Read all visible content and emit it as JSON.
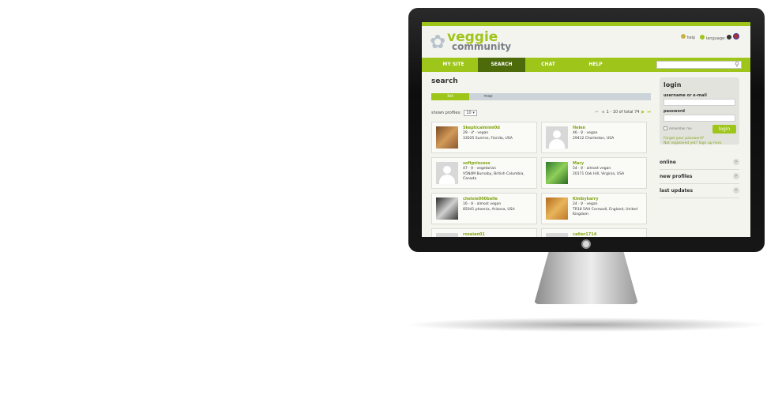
{
  "header": {
    "logo_top": "veggie",
    "logo_bottom": "community",
    "help": "help",
    "language": "language:"
  },
  "nav": {
    "tabs": [
      "MY SITE",
      "SEARCH",
      "CHAT",
      "HELP"
    ],
    "active": "SEARCH",
    "search_value": ""
  },
  "search": {
    "title": "search",
    "views": [
      "list",
      "map"
    ],
    "active_view": "list",
    "shown_profiles_label": "shown profiles:",
    "shown_profiles_value": "10",
    "pagination": "1 - 10 of total 74"
  },
  "profiles": [
    {
      "name": "Skepticalmimi0d",
      "meta": "29 · ♂ · vegan",
      "loc": "33025 Sunrise, Florida, USA",
      "loc2": ""
    },
    {
      "name": "Helen",
      "meta": "46 · ♀ · vegan",
      "loc": "29412 Charleston, USA",
      "loc2": ""
    },
    {
      "name": "softprincess",
      "meta": "47 · ♀ · vegetarian",
      "loc": "V5N4M Burnaby, British Columbia,",
      "loc2": "Canada"
    },
    {
      "name": "Mary",
      "meta": "54 · ♀ · almost vegan",
      "loc": "20171 Oak Hill, Virginia, USA",
      "loc2": ""
    },
    {
      "name": "chelsie000belle",
      "meta": "16 · ♀ · almost vegan",
      "loc": "85041 phoenix, Arizona, USA",
      "loc2": ""
    },
    {
      "name": "Kimbykarry",
      "meta": "24 · ♀ · vegan",
      "loc": "TR18 5AH Cornwall, England, United",
      "loc2": "Kingdom"
    },
    {
      "name": "roseien01",
      "meta": "",
      "loc": "",
      "loc2": ""
    },
    {
      "name": "calter1714",
      "meta": "",
      "loc": "",
      "loc2": ""
    }
  ],
  "login": {
    "title": "login",
    "username_label": "username or e-mail",
    "password_label": "password",
    "remember": "remember me",
    "button": "login",
    "forgot": "Forgot your password?",
    "register": "Not registered yet? Sign up here."
  },
  "sidebar_sections": [
    "online",
    "new profiles",
    "last updates"
  ]
}
